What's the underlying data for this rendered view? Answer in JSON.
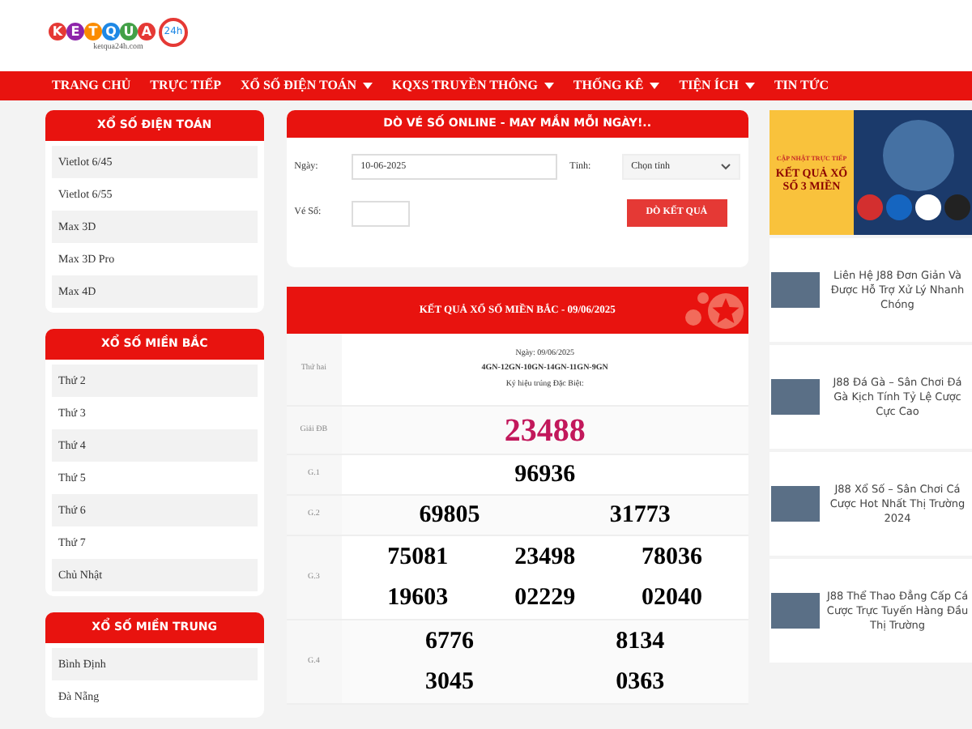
{
  "logo": {
    "letters": [
      "K",
      "E",
      "T",
      "Q",
      "U",
      "A"
    ],
    "badge": "24h",
    "domain": "ketqua24h.com"
  },
  "nav": [
    {
      "label": "TRANG CHỦ",
      "has_menu": false
    },
    {
      "label": "TRỰC TIẾP",
      "has_menu": false
    },
    {
      "label": "XỔ SỐ ĐIỆN TOÁN",
      "has_menu": true
    },
    {
      "label": "KQXS TRUYỀN THÔNG",
      "has_menu": true
    },
    {
      "label": "THỐNG KÊ",
      "has_menu": true
    },
    {
      "label": "TIỆN ÍCH",
      "has_menu": true
    },
    {
      "label": "TIN TỨC",
      "has_menu": false
    }
  ],
  "sidebar": [
    {
      "title": "XỔ SỐ ĐIỆN TOÁN",
      "items": [
        "Vietlot 6/45",
        "Vietlot 6/55",
        "Max 3D",
        "Max 3D Pro",
        "Max 4D"
      ]
    },
    {
      "title": "XỔ SỐ MIỀN BẮC",
      "items": [
        "Thứ 2",
        "Thứ 3",
        "Thứ 4",
        "Thứ 5",
        "Thứ 6",
        "Thứ 7",
        "Chủ Nhật"
      ]
    },
    {
      "title": "XỔ SỐ MIỀN TRUNG",
      "items": [
        "Bình Định",
        "Đà Nẵng"
      ]
    }
  ],
  "ticket_check": {
    "title": "DÒ VÉ SỐ ONLINE - MAY MẮN MỖI NGÀY!..",
    "date_label": "Ngày:",
    "date_value": "10-06-2025",
    "province_label": "Tỉnh:",
    "province_value": "Chọn tỉnh",
    "number_label": "Vé Số:",
    "button": "DÒ KẾT QUẢ"
  },
  "results": {
    "title": "KẾT QUẢ XỔ SỐ MIỀN BẮC - 09/06/2025",
    "day": "Thứ hai",
    "date": "Ngày: 09/06/2025",
    "codes": "4GN-12GN-10GN-14GN-11GN-9GN",
    "note": "Ký hiệu trúng Đặc Biệt:",
    "prizes": [
      {
        "label": "Giải ĐB",
        "kind": "special",
        "numbers": [
          "23488"
        ]
      },
      {
        "label": "G.1",
        "kind": "normal",
        "numbers": [
          "96936"
        ]
      },
      {
        "label": "G.2",
        "kind": "normal",
        "numbers": [
          "69805",
          "31773"
        ]
      },
      {
        "label": "G.3",
        "kind": "normal",
        "numbers": [
          "75081",
          "23498",
          "78036",
          "19603",
          "02229",
          "02040"
        ]
      },
      {
        "label": "G.4",
        "kind": "normal",
        "numbers": [
          "6776",
          "8134",
          "3045",
          "0363"
        ]
      }
    ]
  },
  "banner": {
    "kicker": "CẬP NHẬT TRỰC TIẾP",
    "headline": "KẾT QUẢ XỔ SỐ 3 MIỀN"
  },
  "articles": [
    "Liên Hệ J88 Đơn Giản Và Được Hỗ Trợ Xử Lý Nhanh Chóng",
    "J88 Đá Gà – Sân Chơi Đá Gà Kịch Tính Tỷ Lệ Cược Cực Cao",
    "J88 Xổ Số – Sân Chơi Cá Cược Hot Nhất Thị Trường 2024",
    "J88 Thể Thao Đẳng Cấp Cá Cược Trực Tuyến Hàng Đầu Thị Trường"
  ]
}
